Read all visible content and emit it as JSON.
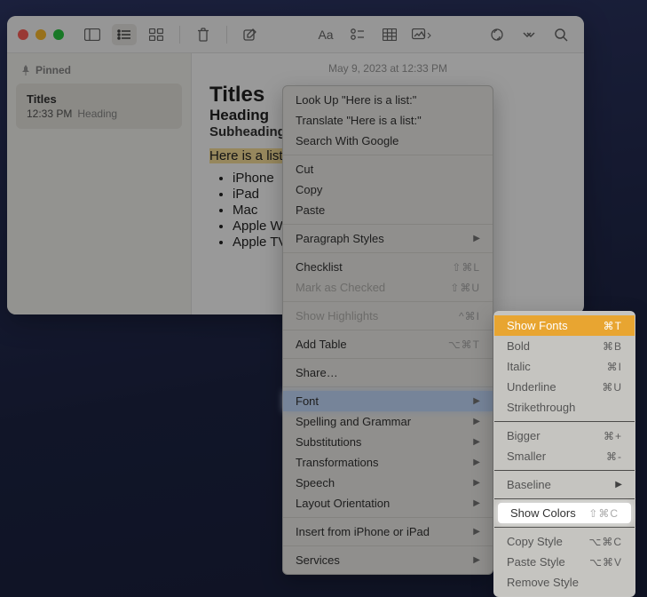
{
  "window": {
    "traffic": [
      "close",
      "minimize",
      "zoom"
    ]
  },
  "sidebar": {
    "pinned_label": "Pinned",
    "items": [
      {
        "title": "Titles",
        "time": "12:33 PM",
        "preview": "Heading"
      }
    ]
  },
  "content": {
    "timestamp": "May 9, 2023 at 12:33 PM",
    "title": "Titles",
    "heading": "Heading",
    "subheading": "Subheading",
    "highlighted_line": "Here is a list:",
    "list": [
      "iPhone",
      "iPad",
      "Mac",
      "Apple Wa",
      "Apple TV"
    ]
  },
  "context_menu": {
    "lookup": "Look Up \"Here is a list:\"",
    "translate": "Translate \"Here is a list:\"",
    "search": "Search With Google",
    "cut": "Cut",
    "copy": "Copy",
    "paste": "Paste",
    "paragraph_styles": "Paragraph Styles",
    "checklist": "Checklist",
    "checklist_sc": "⇧⌘L",
    "mark_checked": "Mark as Checked",
    "mark_checked_sc": "⇧⌘U",
    "show_highlights": "Show Highlights",
    "show_highlights_sc": "^⌘I",
    "add_table": "Add Table",
    "add_table_sc": "⌥⌘T",
    "share": "Share…",
    "font": "Font",
    "spelling": "Spelling and Grammar",
    "substitutions": "Substitutions",
    "transformations": "Transformations",
    "speech": "Speech",
    "layout": "Layout Orientation",
    "insert": "Insert from iPhone or iPad",
    "services": "Services"
  },
  "font_submenu": {
    "show_fonts": "Show Fonts",
    "show_fonts_sc": "⌘T",
    "bold": "Bold",
    "bold_sc": "⌘B",
    "italic": "Italic",
    "italic_sc": "⌘I",
    "underline": "Underline",
    "underline_sc": "⌘U",
    "strikethrough": "Strikethrough",
    "bigger": "Bigger",
    "bigger_sc": "⌘+",
    "smaller": "Smaller",
    "smaller_sc": "⌘-",
    "baseline": "Baseline",
    "show_colors": "Show Colors",
    "show_colors_sc": "⇧⌘C",
    "copy_style": "Copy Style",
    "copy_style_sc": "⌥⌘C",
    "paste_style": "Paste Style",
    "paste_style_sc": "⌥⌘V",
    "remove_style": "Remove Style"
  }
}
